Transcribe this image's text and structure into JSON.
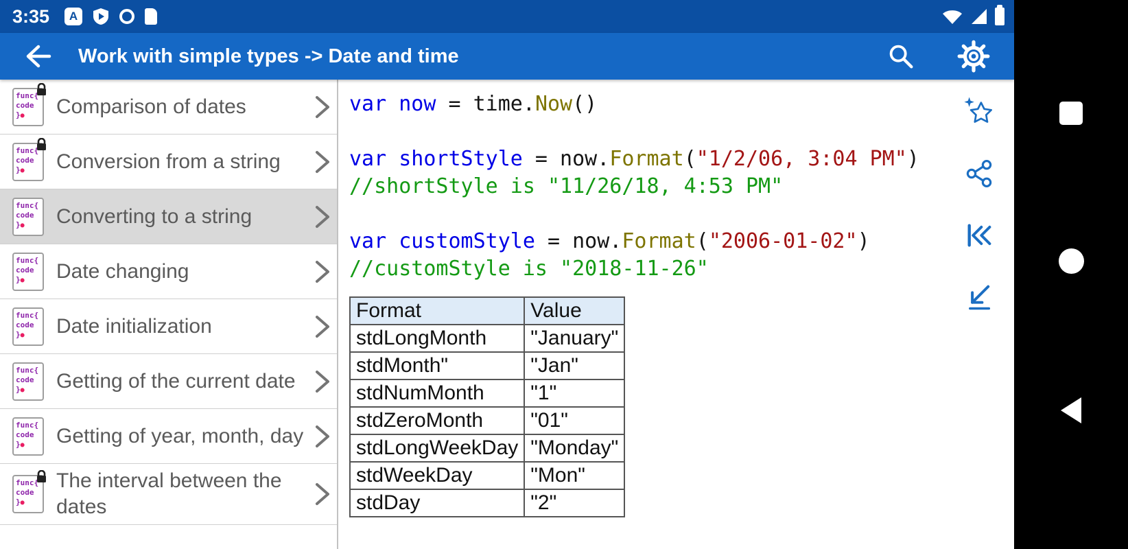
{
  "status_bar": {
    "time": "3:35",
    "notification_icons": [
      "translate-icon",
      "play-protect-icon",
      "record-ring-icon",
      "sim-card-icon"
    ],
    "status_icons": [
      "wifi-icon",
      "signal-icon",
      "battery-icon"
    ]
  },
  "app_bar": {
    "title": "Work with simple types -> Date and time",
    "icons": [
      "back-arrow-icon",
      "search-icon",
      "settings-gear-icon"
    ]
  },
  "sidebar": {
    "icon_lines": [
      "func{",
      "code",
      "}"
    ],
    "items": [
      {
        "label": "Comparison of dates",
        "locked": true,
        "selected": false
      },
      {
        "label": "Conversion from a string",
        "locked": true,
        "selected": false
      },
      {
        "label": "Converting to a string",
        "locked": false,
        "selected": true
      },
      {
        "label": "Date changing",
        "locked": false,
        "selected": false
      },
      {
        "label": "Date initialization",
        "locked": false,
        "selected": false
      },
      {
        "label": "Getting of the current date",
        "locked": false,
        "selected": false
      },
      {
        "label": "Getting of year, month, day",
        "locked": false,
        "selected": false
      },
      {
        "label": "The interval between the dates",
        "locked": true,
        "selected": false
      }
    ]
  },
  "code": {
    "lines": [
      [
        [
          "kw",
          "var now"
        ],
        [
          "pl",
          " = time."
        ],
        [
          "fn",
          "Now"
        ],
        [
          "pl",
          "()"
        ]
      ],
      [],
      [
        [
          "kw",
          "var shortStyle"
        ],
        [
          "pl",
          " = now."
        ],
        [
          "fn",
          "Format"
        ],
        [
          "pl",
          "("
        ],
        [
          "str",
          "\"1/2/06, 3:04 PM\""
        ],
        [
          "pl",
          ")"
        ]
      ],
      [
        [
          "com",
          "//shortStyle is \"11/26/18, 4:53 PM\""
        ]
      ],
      [],
      [
        [
          "kw",
          "var customStyle"
        ],
        [
          "pl",
          " = now."
        ],
        [
          "fn",
          "Format"
        ],
        [
          "pl",
          "("
        ],
        [
          "str",
          "\"2006-01-02\""
        ],
        [
          "pl",
          ")"
        ]
      ],
      [
        [
          "com",
          "//customStyle is \"2018-11-26\""
        ]
      ]
    ]
  },
  "table": {
    "headers": [
      "Format",
      "Value"
    ],
    "rows": [
      [
        "stdLongMonth",
        "\"January\""
      ],
      [
        "stdMonth\"",
        "\"Jan\""
      ],
      [
        "stdNumMonth",
        "\"1\""
      ],
      [
        "stdZeroMonth",
        "\"01\""
      ],
      [
        "stdLongWeekDay",
        "\"Monday\""
      ],
      [
        "stdWeekDay",
        "\"Mon\""
      ],
      [
        "stdDay",
        "\"2\""
      ]
    ]
  },
  "action_rail": {
    "icons": [
      "favorite-star-icon",
      "share-icon",
      "skip-to-start-icon",
      "jump-to-bottom-icon"
    ],
    "accent_color": "#1b6ec2"
  },
  "nav_bar": {
    "icons": [
      "recents-square-icon",
      "home-circle-icon",
      "back-triangle-icon"
    ]
  },
  "colors": {
    "status_bar": "#0b4fa2",
    "app_bar": "#1568c5",
    "selected_item_bg": "#d9d9d9",
    "table_header_bg": "#deebf8",
    "keyword": "#0000e6",
    "function": "#7d7400",
    "string": "#a31515",
    "comment": "#149a14"
  }
}
